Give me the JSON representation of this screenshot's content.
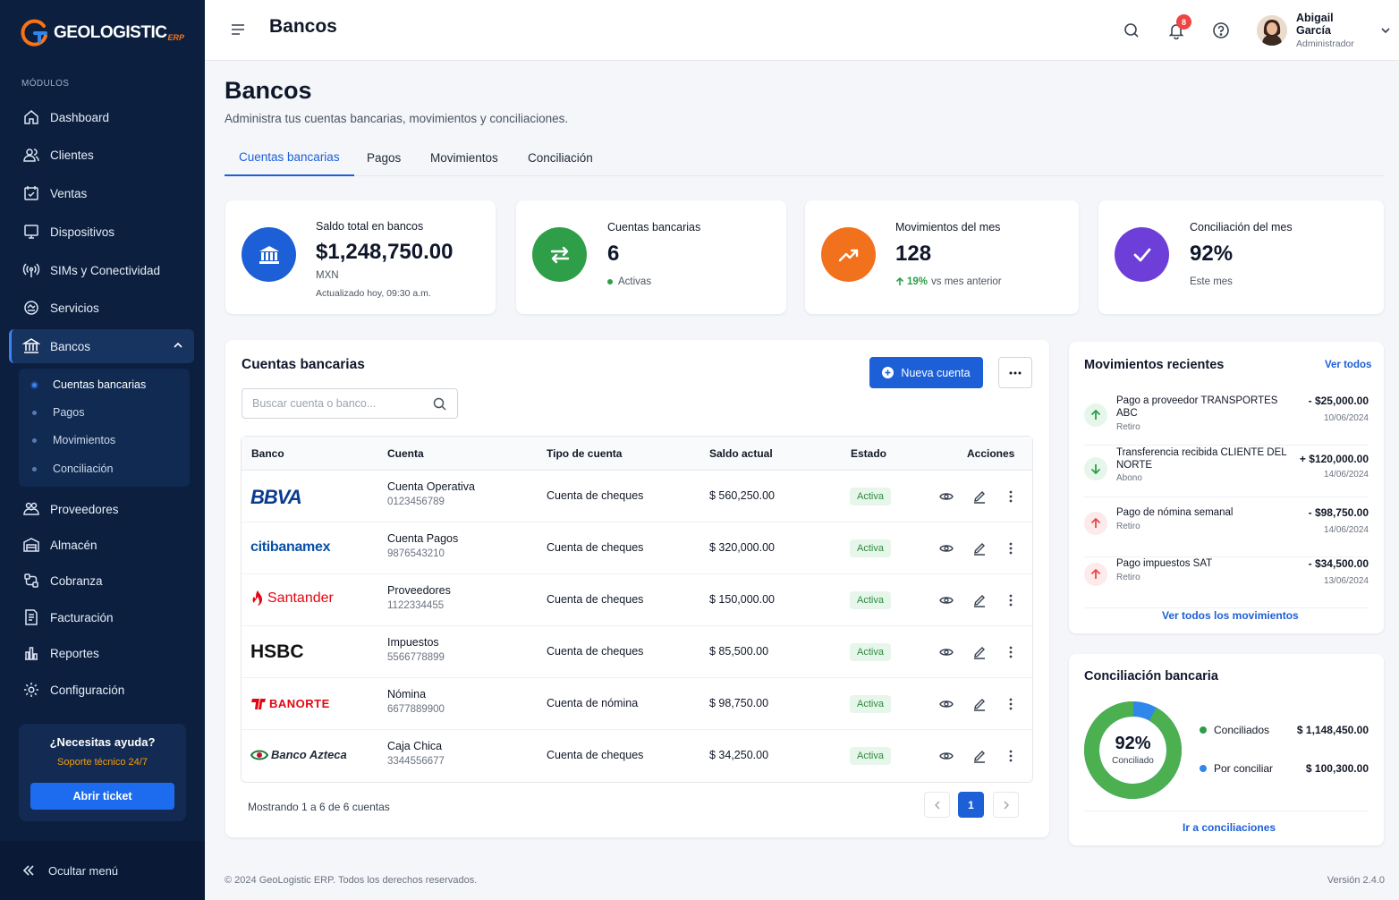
{
  "app": {
    "logo_text": "GEOLOGISTIC",
    "logo_suffix": "ERP",
    "colors": {
      "sidebar": "#0c1f3f",
      "accent": "#1d5fd6",
      "success": "#2e9e49",
      "warning": "#f2711c",
      "purple": "#6d3fd8"
    }
  },
  "sidebar": {
    "section_label": "MÓDULOS",
    "items": [
      {
        "label": "Dashboard",
        "icon": "home-icon"
      },
      {
        "label": "Clientes",
        "icon": "users-icon"
      },
      {
        "label": "Ventas",
        "icon": "sales-icon"
      },
      {
        "label": "Dispositivos",
        "icon": "monitor-icon"
      },
      {
        "label": "SIMs y Conectividad",
        "icon": "signal-icon"
      },
      {
        "label": "Servicios",
        "icon": "services-icon"
      },
      {
        "label": "Bancos",
        "icon": "bank-icon"
      },
      {
        "label": "Proveedores",
        "icon": "suppliers-icon"
      },
      {
        "label": "Almacén",
        "icon": "warehouse-icon"
      },
      {
        "label": "Cobranza",
        "icon": "collection-icon"
      },
      {
        "label": "Facturación",
        "icon": "invoice-icon"
      },
      {
        "label": "Reportes",
        "icon": "reports-icon"
      },
      {
        "label": "Configuración",
        "icon": "gear-icon"
      }
    ],
    "subitems": [
      "Cuentas bancarias",
      "Pagos",
      "Movimientos",
      "Conciliación"
    ],
    "help": {
      "title": "¿Necesitas ayuda?",
      "subtitle": "Soporte técnico 24/7",
      "button": "Abrir ticket"
    },
    "collapse_label": "Ocultar menú"
  },
  "topbar": {
    "title": "Bancos",
    "notifications_count": "8",
    "user": {
      "name": "Abigail García",
      "role": "Administrador"
    }
  },
  "page": {
    "title": "Bancos",
    "subtitle": "Administra tus cuentas bancarias, movimientos y conciliaciones.",
    "tabs": [
      "Cuentas bancarias",
      "Pagos",
      "Movimientos",
      "Conciliación"
    ]
  },
  "stats": [
    {
      "label": "Saldo total en bancos",
      "value": "$1,248,750.00",
      "currency": "MXN",
      "note": "Actualizado hoy, 09:30 a.m.",
      "icon": "bank-icon",
      "color": "#1d5fd6"
    },
    {
      "label": "Cuentas bancarias",
      "value": "6",
      "note": "Activas",
      "icon": "transfer-icon",
      "color": "#2e9e49"
    },
    {
      "label": "Movimientos del mes",
      "value": "128",
      "trend": "19%",
      "note": "vs mes anterior",
      "icon": "trend-up-icon",
      "color": "#f2711c"
    },
    {
      "label": "Conciliación del mes",
      "value": "92%",
      "note": "Este mes",
      "icon": "check-icon",
      "color": "#6d3fd8"
    }
  ],
  "accounts": {
    "title": "Cuentas bancarias",
    "new_button": "Nueva cuenta",
    "search_placeholder": "Buscar cuenta o banco...",
    "columns": [
      "Banco",
      "Cuenta",
      "Tipo de cuenta",
      "Saldo actual",
      "Estado",
      "Acciones"
    ],
    "rows": [
      {
        "bank": "BBVA",
        "name": "Cuenta Operativa",
        "number": "0123456789",
        "type": "Cuenta de cheques",
        "balance": "$ 560,250.00",
        "status": "Activa"
      },
      {
        "bank": "citibanamex",
        "name": "Cuenta Pagos",
        "number": "9876543210",
        "type": "Cuenta de cheques",
        "balance": "$ 320,000.00",
        "status": "Activa"
      },
      {
        "bank": "Santander",
        "name": "Proveedores",
        "number": "1122334455",
        "type": "Cuenta de cheques",
        "balance": "$ 150,000.00",
        "status": "Activa"
      },
      {
        "bank": "HSBC",
        "name": "Impuestos",
        "number": "5566778899",
        "type": "Cuenta de cheques",
        "balance": "$ 85,500.00",
        "status": "Activa"
      },
      {
        "bank": "BANORTE",
        "name": "Nómina",
        "number": "6677889900",
        "type": "Cuenta de nómina",
        "balance": "$ 98,750.00",
        "status": "Activa"
      },
      {
        "bank": "Banco Azteca",
        "name": "Caja Chica",
        "number": "3344556677",
        "type": "Cuenta de cheques",
        "balance": "$ 34,250.00",
        "status": "Activa"
      }
    ],
    "pagination_text": "Mostrando 1 a 6 de 6 cuentas",
    "current_page": "1"
  },
  "recent": {
    "title": "Movimientos recientes",
    "view_all": "Ver todos",
    "items": [
      {
        "desc": "Pago a proveedor TRANSPORTES ABC",
        "type": "Retiro",
        "amount": "- $25,000.00",
        "date": "10/06/2024",
        "direction": "out-up"
      },
      {
        "desc": "Transferencia recibida CLIENTE DEL NORTE",
        "type": "Abono",
        "amount": "+ $120,000.00",
        "date": "14/06/2024",
        "direction": "in"
      },
      {
        "desc": "Pago de nómina semanal",
        "type": "Retiro",
        "amount": "- $98,750.00",
        "date": "14/06/2024",
        "direction": "out"
      },
      {
        "desc": "Pago impuestos SAT",
        "type": "Retiro",
        "amount": "- $34,500.00",
        "date": "13/06/2024",
        "direction": "out"
      }
    ],
    "footer_link": "Ver todos los movimientos"
  },
  "reconciliation": {
    "title": "Conciliación bancaria",
    "percent_label": "92%",
    "percent_caption": "Conciliado",
    "percent": 0.92,
    "legend": [
      {
        "label": "Conciliados",
        "value": "$ 1,148,450.00",
        "color": "#2e9e49"
      },
      {
        "label": "Por conciliar",
        "value": "$ 100,300.00",
        "color": "#2f86eb"
      }
    ],
    "link": "Ir a conciliaciones"
  },
  "footer": {
    "copyright": "© 2024 GeoLogistic ERP. Todos los derechos reservados.",
    "version": "Versión 2.4.0"
  }
}
